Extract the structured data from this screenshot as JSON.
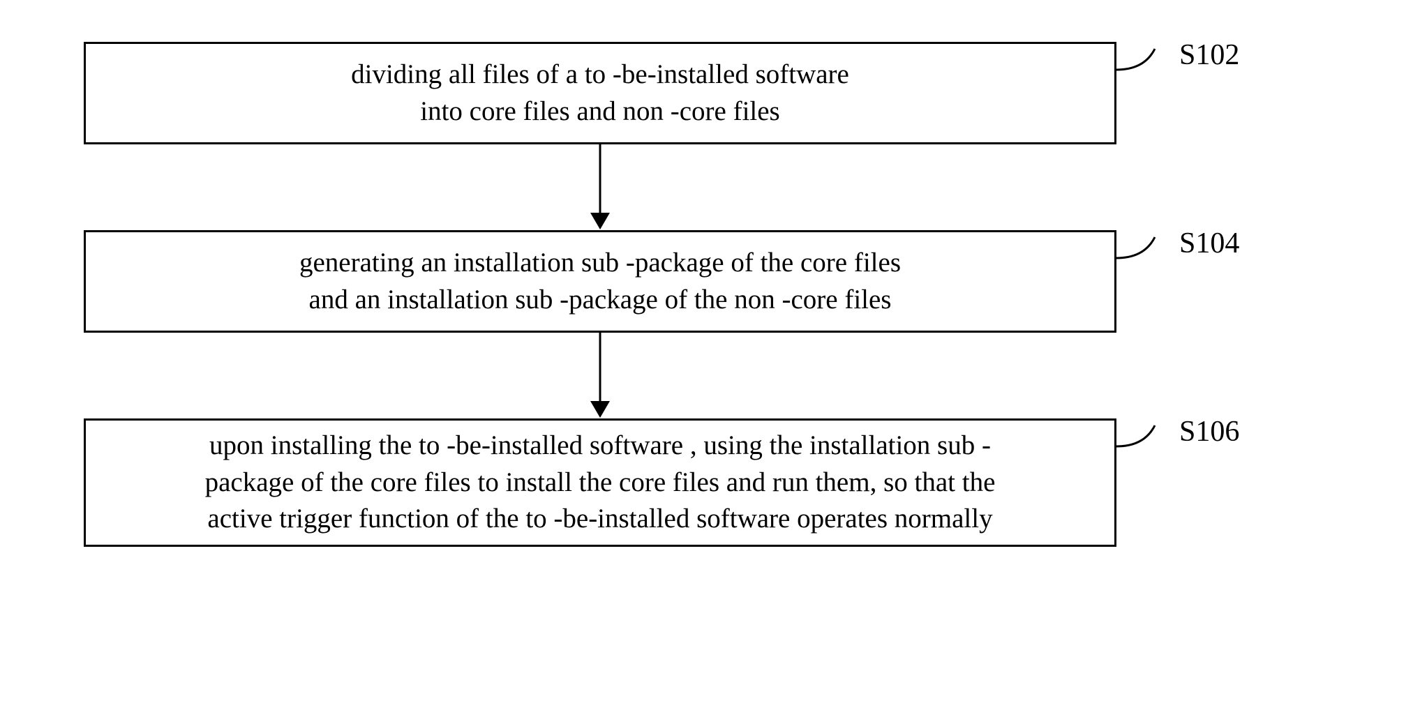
{
  "flowchart": {
    "steps": [
      {
        "label": "S102",
        "text_line1": "dividing all files of a to -be-installed software",
        "text_line2": "into core files and non -core files"
      },
      {
        "label": "S104",
        "text_line1": "generating an installation sub -package of the core files",
        "text_line2": "and an installation sub -package of the non -core files"
      },
      {
        "label": "S106",
        "text_line1": "upon installing the to -be-installed software , using the installation sub -",
        "text_line2": "package of the core files to install the core files and run   them, so that the",
        "text_line3": "active trigger function of the to -be-installed software operates normally"
      }
    ]
  }
}
